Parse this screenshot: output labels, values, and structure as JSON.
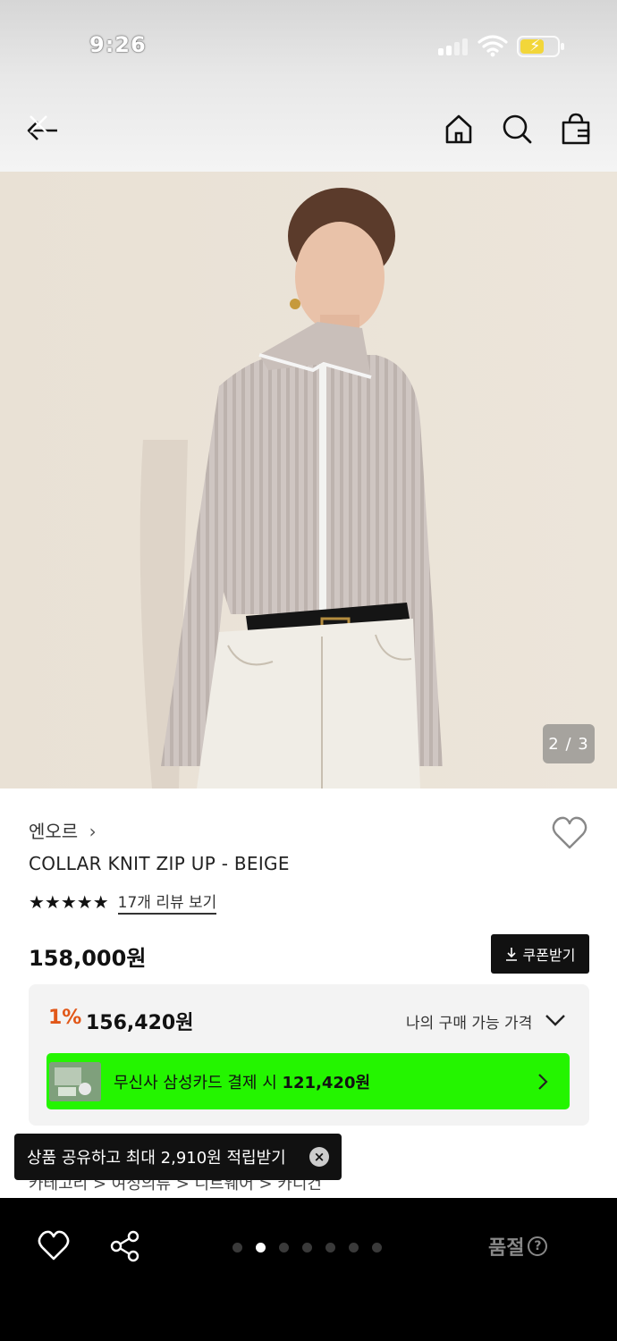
{
  "status_bar": {
    "time": "9:26"
  },
  "header": {
    "back_icon": "back-arrow-icon",
    "icons": [
      "home-icon",
      "search-icon",
      "shopping-bag-icon"
    ]
  },
  "hero": {
    "counter": "2 / 3"
  },
  "product": {
    "brand": "엔오르",
    "name": "COLLAR KNIT ZIP UP - BEIGE",
    "stars": "★★★★★",
    "reviews_link": "17개 리뷰 보기",
    "price": "158,000원",
    "coupon_label": "쿠폰받기"
  },
  "price_box": {
    "discount_pct": "1%",
    "sale_price": "156,420원",
    "my_price_label": "나의 구매 가능 가격",
    "card_text_prefix": "무신사 삼성카드 결제 시 ",
    "card_price": "121,420원",
    "card_color": "#24f500",
    "discount_color": "#e15718"
  },
  "breadcrumb": "카테고리 > 여성의류 > 니트웨어 > 카디건",
  "toast": {
    "message": "상품 공유하고 최대 2,910원 적립받기"
  },
  "bottom_bar": {
    "dots_total": 7,
    "active_dot": 2,
    "soldout_label": "품절",
    "help_glyph": "?"
  }
}
